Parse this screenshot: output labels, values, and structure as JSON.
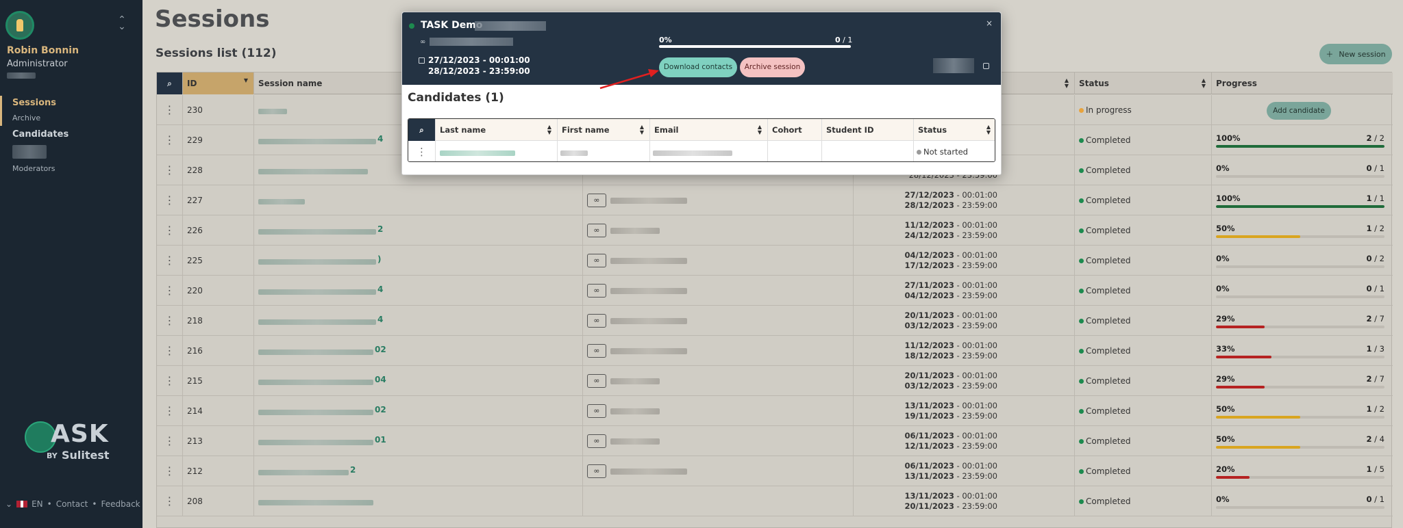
{
  "sidebar": {
    "user_name": "Robin Bonnin",
    "user_role": "Administrator",
    "nav": {
      "sessions": "Sessions",
      "archive": "Archive",
      "candidates": "Candidates",
      "moderators": "Moderators"
    },
    "logo_text": "ASK",
    "logo_by": "BY",
    "logo_brand": "Sulitest",
    "footer": {
      "language": "EN",
      "contact": "Contact",
      "feedback": "Feedback",
      "separator": "•"
    }
  },
  "main": {
    "title": "Sessions",
    "list_title": "Sessions list (112)",
    "new_session_label": "New session",
    "columns": {
      "id": "ID",
      "name": "Session name",
      "status": "Status",
      "progress": "Progress"
    },
    "add_candidate_label": "Add candidate",
    "rows": [
      {
        "id": "230",
        "suffix": "",
        "start": "",
        "end": "",
        "status": "In progress",
        "status_color": "#e8a33c",
        "pct": "",
        "done": "",
        "total": "",
        "progress_fraction": null,
        "bar_color": ""
      },
      {
        "id": "229",
        "suffix": "4",
        "start": "",
        "end": "",
        "status": "Completed",
        "status_color": "#1d8a4f",
        "pct": "100%",
        "done": "2",
        "total": "2",
        "progress_fraction": 1.0,
        "bar_color": "#1f6b3a"
      },
      {
        "id": "228",
        "suffix": "",
        "start": "",
        "end": "28/12/2023 - 23:59:00",
        "status": "Completed",
        "status_color": "#1d8a4f",
        "pct": "0%",
        "done": "0",
        "total": "1",
        "progress_fraction": 0,
        "bar_color": "#1f6b3a"
      },
      {
        "id": "227",
        "suffix": "",
        "start": "27/12/2023",
        "end": "28/12/2023",
        "start_time": "00:01:00",
        "end_time": "23:59:00",
        "status": "Completed",
        "status_color": "#1d8a4f",
        "pct": "100%",
        "done": "1",
        "total": "1",
        "progress_fraction": 1.0,
        "bar_color": "#1f6b3a"
      },
      {
        "id": "226",
        "suffix": "2",
        "start": "11/12/2023",
        "end": "24/12/2023",
        "start_time": "00:01:00",
        "end_time": "23:59:00",
        "status": "Completed",
        "status_color": "#1d8a4f",
        "pct": "50%",
        "done": "1",
        "total": "2",
        "progress_fraction": 0.5,
        "bar_color": "#d9a520"
      },
      {
        "id": "225",
        "suffix": ")",
        "start": "04/12/2023",
        "end": "17/12/2023",
        "start_time": "00:01:00",
        "end_time": "23:59:00",
        "status": "Completed",
        "status_color": "#1d8a4f",
        "pct": "0%",
        "done": "0",
        "total": "2",
        "progress_fraction": 0,
        "bar_color": "#d9a520"
      },
      {
        "id": "220",
        "suffix": "4",
        "start": "27/11/2023",
        "end": "04/12/2023",
        "start_time": "00:01:00",
        "end_time": "23:59:00",
        "status": "Completed",
        "status_color": "#1d8a4f",
        "pct": "0%",
        "done": "0",
        "total": "1",
        "progress_fraction": 0,
        "bar_color": "#d9a520"
      },
      {
        "id": "218",
        "suffix": "4",
        "start": "20/11/2023",
        "end": "03/12/2023",
        "start_time": "00:01:00",
        "end_time": "23:59:00",
        "status": "Completed",
        "status_color": "#1d8a4f",
        "pct": "29%",
        "done": "2",
        "total": "7",
        "progress_fraction": 0.29,
        "bar_color": "#b52222"
      },
      {
        "id": "216",
        "suffix": "02",
        "start": "11/12/2023",
        "end": "18/12/2023",
        "start_time": "00:01:00",
        "end_time": "23:59:00",
        "status": "Completed",
        "status_color": "#1d8a4f",
        "pct": "33%",
        "done": "1",
        "total": "3",
        "progress_fraction": 0.33,
        "bar_color": "#b52222"
      },
      {
        "id": "215",
        "suffix": "04",
        "start": "20/11/2023",
        "end": "03/12/2023",
        "start_time": "00:01:00",
        "end_time": "23:59:00",
        "status": "Completed",
        "status_color": "#1d8a4f",
        "pct": "29%",
        "done": "2",
        "total": "7",
        "progress_fraction": 0.29,
        "bar_color": "#b52222"
      },
      {
        "id": "214",
        "suffix": "02",
        "start": "13/11/2023",
        "end": "19/11/2023",
        "start_time": "00:01:00",
        "end_time": "23:59:00",
        "status": "Completed",
        "status_color": "#1d8a4f",
        "pct": "50%",
        "done": "1",
        "total": "2",
        "progress_fraction": 0.5,
        "bar_color": "#d9a520"
      },
      {
        "id": "213",
        "suffix": "01",
        "start": "06/11/2023",
        "end": "12/11/2023",
        "start_time": "00:01:00",
        "end_time": "23:59:00",
        "status": "Completed",
        "status_color": "#1d8a4f",
        "pct": "50%",
        "done": "2",
        "total": "4",
        "progress_fraction": 0.5,
        "bar_color": "#d9a520"
      },
      {
        "id": "212",
        "suffix": "2",
        "start": "06/11/2023",
        "end": "13/11/2023",
        "start_time": "00:01:00",
        "end_time": "23:59:00",
        "status": "Completed",
        "status_color": "#1d8a4f",
        "pct": "20%",
        "done": "1",
        "total": "5",
        "progress_fraction": 0.2,
        "bar_color": "#b52222"
      },
      {
        "id": "208",
        "suffix": "",
        "start": "13/11/2023",
        "end": "20/11/2023",
        "start_time": "00:01:00",
        "end_time": "23:59:00",
        "status": "Completed",
        "status_color": "#1d8a4f",
        "pct": "0%",
        "done": "0",
        "total": "1",
        "progress_fraction": 0,
        "bar_color": "#d9a520"
      }
    ]
  },
  "modal": {
    "title": "TASK Demo",
    "status_color": "#1d8a4f",
    "close_label": "×",
    "start_datetime": "27/12/2023 - 00:01:00",
    "end_datetime": "28/12/2023 - 23:59:00",
    "progress_pct": "0%",
    "progress_done": "0",
    "progress_total": "1",
    "download_contacts_label": "Download contacts",
    "archive_session_label": "Archive session",
    "candidates_title": "Candidates (1)",
    "candidate_columns": {
      "last_name": "Last name",
      "first_name": "First name",
      "email": "Email",
      "cohort": "Cohort",
      "student_id": "Student ID",
      "status": "Status"
    },
    "candidate_row": {
      "status": "Not started",
      "status_color": "#9a9a9a"
    }
  }
}
